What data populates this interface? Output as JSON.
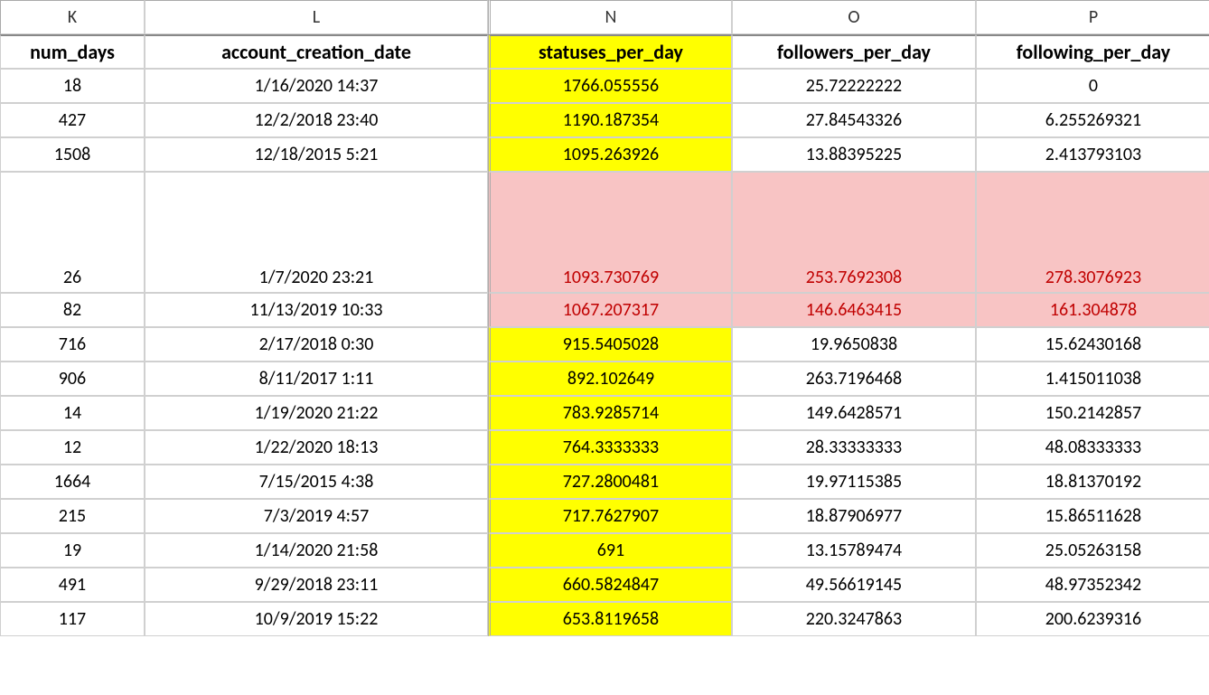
{
  "columns": {
    "letters": [
      "K",
      "L",
      "N",
      "O",
      "P"
    ],
    "headers": [
      "num_days",
      "account_creation_date",
      "statuses_per_day",
      "followers_per_day",
      "following_per_day"
    ]
  },
  "rows": [
    {
      "num_days": "18",
      "date": "1/16/2020 14:37",
      "statuses": "1766.055556",
      "followers": "25.72222222",
      "following": "0",
      "tall": false,
      "style": "yellow"
    },
    {
      "num_days": "427",
      "date": "12/2/2018 23:40",
      "statuses": "1190.187354",
      "followers": "27.84543326",
      "following": "6.255269321",
      "tall": false,
      "style": "yellow"
    },
    {
      "num_days": "1508",
      "date": "12/18/2015 5:21",
      "statuses": "1095.263926",
      "followers": "13.88395225",
      "following": "2.413793103",
      "tall": false,
      "style": "yellow"
    },
    {
      "num_days": "26",
      "date": "1/7/2020 23:21",
      "statuses": "1093.730769",
      "followers": "253.7692308",
      "following": "278.3076923",
      "tall": true,
      "style": "pink"
    },
    {
      "num_days": "82",
      "date": "11/13/2019 10:33",
      "statuses": "1067.207317",
      "followers": "146.6463415",
      "following": "161.304878",
      "tall": false,
      "style": "pink"
    },
    {
      "num_days": "716",
      "date": "2/17/2018 0:30",
      "statuses": "915.5405028",
      "followers": "19.9650838",
      "following": "15.62430168",
      "tall": false,
      "style": "yellow"
    },
    {
      "num_days": "906",
      "date": "8/11/2017 1:11",
      "statuses": "892.102649",
      "followers": "263.7196468",
      "following": "1.415011038",
      "tall": false,
      "style": "yellow"
    },
    {
      "num_days": "14",
      "date": "1/19/2020 21:22",
      "statuses": "783.9285714",
      "followers": "149.6428571",
      "following": "150.2142857",
      "tall": false,
      "style": "yellow"
    },
    {
      "num_days": "12",
      "date": "1/22/2020 18:13",
      "statuses": "764.3333333",
      "followers": "28.33333333",
      "following": "48.08333333",
      "tall": false,
      "style": "yellow"
    },
    {
      "num_days": "1664",
      "date": "7/15/2015 4:38",
      "statuses": "727.2800481",
      "followers": "19.97115385",
      "following": "18.81370192",
      "tall": false,
      "style": "yellow"
    },
    {
      "num_days": "215",
      "date": "7/3/2019 4:57",
      "statuses": "717.7627907",
      "followers": "18.87906977",
      "following": "15.86511628",
      "tall": false,
      "style": "yellow"
    },
    {
      "num_days": "19",
      "date": "1/14/2020 21:58",
      "statuses": "691",
      "followers": "13.15789474",
      "following": "25.05263158",
      "tall": false,
      "style": "yellow"
    },
    {
      "num_days": "491",
      "date": "9/29/2018 23:11",
      "statuses": "660.5824847",
      "followers": "49.56619145",
      "following": "48.97352342",
      "tall": false,
      "style": "yellow"
    },
    {
      "num_days": "117",
      "date": "10/9/2019 15:22",
      "statuses": "653.8119658",
      "followers": "220.3247863",
      "following": "200.6239316",
      "tall": false,
      "style": "yellow"
    }
  ],
  "chart_data": {
    "type": "table",
    "title": "",
    "columns": [
      "num_days",
      "account_creation_date",
      "statuses_per_day",
      "followers_per_day",
      "following_per_day"
    ],
    "rows": [
      [
        18,
        "1/16/2020 14:37",
        1766.055556,
        25.72222222,
        0
      ],
      [
        427,
        "12/2/2018 23:40",
        1190.187354,
        27.84543326,
        6.255269321
      ],
      [
        1508,
        "12/18/2015 5:21",
        1095.263926,
        13.88395225,
        2.413793103
      ],
      [
        26,
        "1/7/2020 23:21",
        1093.730769,
        253.7692308,
        278.3076923
      ],
      [
        82,
        "11/13/2019 10:33",
        1067.207317,
        146.6463415,
        161.304878
      ],
      [
        716,
        "2/17/2018 0:30",
        915.5405028,
        19.9650838,
        15.62430168
      ],
      [
        906,
        "8/11/2017 1:11",
        892.102649,
        263.7196468,
        1.415011038
      ],
      [
        14,
        "1/19/2020 21:22",
        783.9285714,
        149.6428571,
        150.2142857
      ],
      [
        12,
        "1/22/2020 18:13",
        764.3333333,
        28.33333333,
        48.08333333
      ],
      [
        1664,
        "7/15/2015 4:38",
        727.2800481,
        19.97115385,
        18.81370192
      ],
      [
        215,
        "7/3/2019 4:57",
        717.7627907,
        18.87906977,
        15.86511628
      ],
      [
        19,
        "1/14/2020 21:58",
        691,
        13.15789474,
        25.05263158
      ],
      [
        491,
        "9/29/2018 23:11",
        660.5824847,
        49.56619145,
        48.97352342
      ],
      [
        117,
        "10/9/2019 15:22",
        653.8119658,
        220.3247863,
        200.6239316
      ]
    ]
  }
}
